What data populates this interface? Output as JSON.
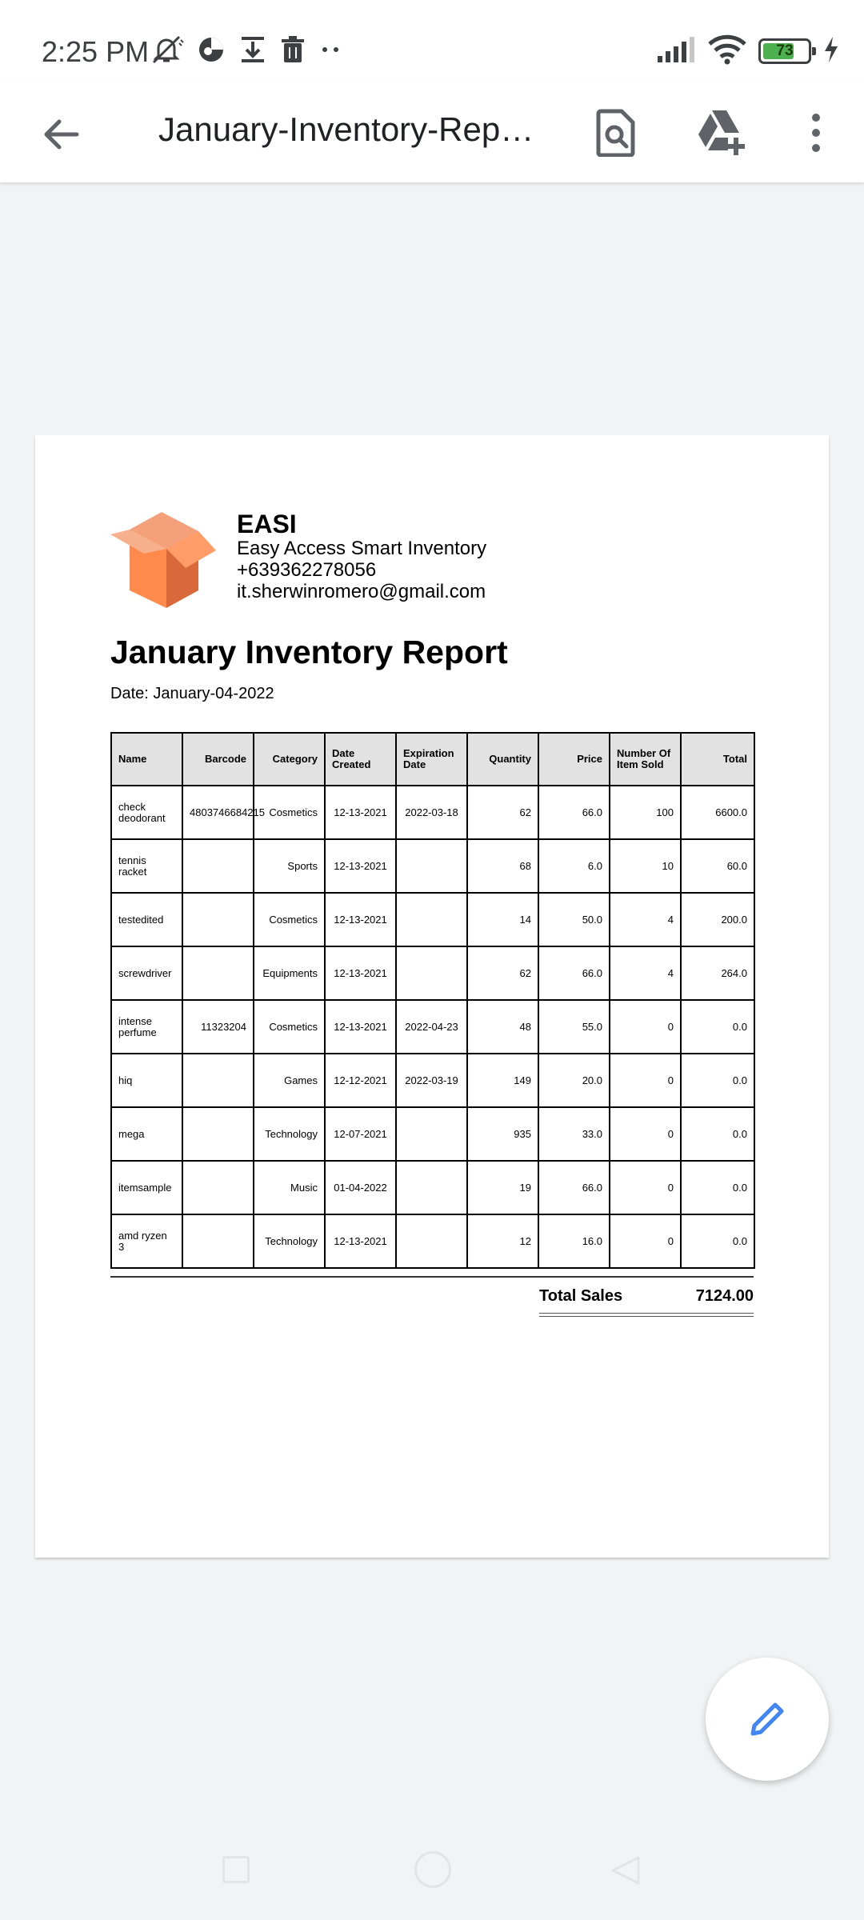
{
  "status_bar": {
    "time": "2:25 PM",
    "battery_level": "73",
    "battery_fraction": 0.73,
    "icons": [
      "notifications-muted-icon",
      "data-saver-icon",
      "download-icon",
      "trash-icon",
      "more-dots-icon",
      "signal-icon",
      "wifi-icon",
      "battery-icon",
      "charging-icon"
    ]
  },
  "app_bar": {
    "title": "January-Inventory-Report.pdf",
    "icons": [
      "back-arrow-icon",
      "find-in-page-icon",
      "drive-add-icon",
      "more-vert-icon"
    ]
  },
  "document": {
    "company": {
      "name": "EASI",
      "full_name": "Easy Access Smart Inventory",
      "phone": "+639362278056",
      "email": "it.sherwinromero@gmail.com"
    },
    "title": "January Inventory Report",
    "date": "Date: January-04-2022",
    "table": {
      "headers": [
        "Name",
        "Barcode",
        "Category",
        "Date Created",
        "Expiration Date",
        "Quantity",
        "Price",
        "Number Of Item Sold",
        "Total"
      ],
      "rows": [
        [
          "check deodorant",
          "4803746684215",
          "Cosmetics",
          "12-13-2021",
          "2022-03-18",
          "62",
          "66.0",
          "100",
          "6600.0"
        ],
        [
          "tennis racket",
          "",
          "Sports",
          "12-13-2021",
          "",
          "68",
          "6.0",
          "10",
          "60.0"
        ],
        [
          "testedited",
          "",
          "Cosmetics",
          "12-13-2021",
          "",
          "14",
          "50.0",
          "4",
          "200.0"
        ],
        [
          "screwdriver",
          "",
          "Equipments",
          "12-13-2021",
          "",
          "62",
          "66.0",
          "4",
          "264.0"
        ],
        [
          "intense perfume",
          "11323204",
          "Cosmetics",
          "12-13-2021",
          "2022-04-23",
          "48",
          "55.0",
          "0",
          "0.0"
        ],
        [
          "hiq",
          "",
          "Games",
          "12-12-2021",
          "2022-03-19",
          "149",
          "20.0",
          "0",
          "0.0"
        ],
        [
          "mega",
          "",
          "Technology",
          "12-07-2021",
          "",
          "935",
          "33.0",
          "0",
          "0.0"
        ],
        [
          "itemsample",
          "",
          "Music",
          "01-04-2022",
          "",
          "19",
          "66.0",
          "0",
          "0.0"
        ],
        [
          "amd ryzen 3",
          "",
          "Technology",
          "12-13-2021",
          "",
          "12",
          "16.0",
          "0",
          "0.0"
        ]
      ]
    },
    "total_sales_label": "Total Sales",
    "total_sales_value": "7124.00"
  },
  "fab": {
    "icon": "edit-pencil-icon"
  },
  "navigation": {
    "icons": [
      "recents-icon",
      "home-icon",
      "back-icon"
    ]
  },
  "colors": {
    "background": "#f1f3f4",
    "app_bar": "#ffffff",
    "fab_icon": "#4285f4",
    "logo_orange": "#ff8a4c",
    "battery_fill": "#4caf50",
    "table_header": "#e2e2e2"
  }
}
